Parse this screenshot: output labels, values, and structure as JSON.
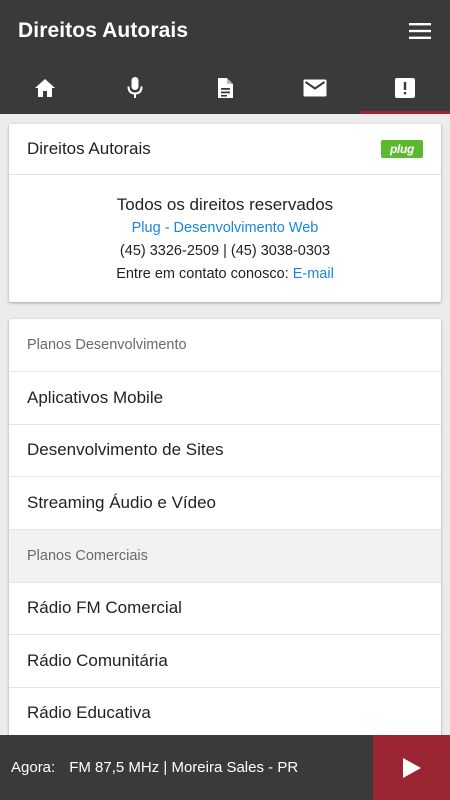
{
  "appbar": {
    "title": "Direitos Autorais",
    "menu_icon": "hamburger-menu-icon"
  },
  "tabs": [
    {
      "icon": "home-icon",
      "active": false
    },
    {
      "icon": "microphone-icon",
      "active": false
    },
    {
      "icon": "document-icon",
      "active": false
    },
    {
      "icon": "mail-icon",
      "active": false
    },
    {
      "icon": "alert-icon",
      "active": true
    }
  ],
  "copyright_card": {
    "title": "Direitos Autorais",
    "logo_text": "plug",
    "line1": "Todos os direitos reservados",
    "company_link": "Plug - Desenvolvimento Web",
    "phones": "(45) 3326-2509 | (45) 3038-0303",
    "contact_prefix": "Entre em contato conosco:",
    "email_link": "E-mail"
  },
  "plans": {
    "development_header": "Planos Desenvolvimento",
    "development_items": [
      "Aplicativos Mobile",
      "Desenvolvimento de Sites",
      "Streaming Áudio e Vídeo"
    ],
    "commercial_header": "Planos Comerciais",
    "commercial_items": [
      "Rádio FM Comercial",
      "Rádio Comunitária",
      "Rádio Educativa"
    ]
  },
  "player": {
    "now_label": "Agora:",
    "station": "FM 87,5 MHz | Moreira Sales - PR",
    "play_icon": "play-icon"
  },
  "colors": {
    "bar_bg": "#3a3a3a",
    "accent": "#9b2535",
    "link": "#1a86d9",
    "logo_green": "#5cb82f"
  }
}
